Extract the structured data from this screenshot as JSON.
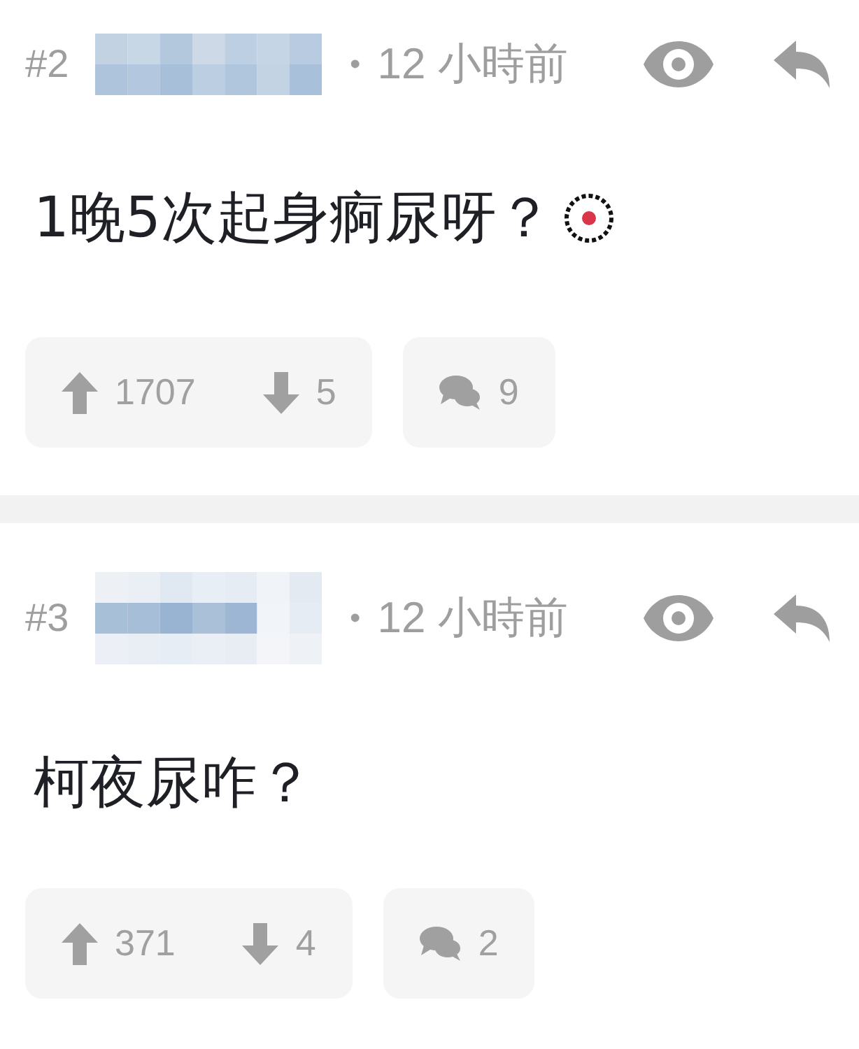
{
  "posts": [
    {
      "number": "#2",
      "separator": "•",
      "time": "12 小時前",
      "body": "1晚5次起身痾尿呀？",
      "emoji": true,
      "upvotes": "1707",
      "downvotes": "5",
      "replies": "9"
    },
    {
      "number": "#3",
      "separator": "•",
      "time": "12 小時前",
      "body": "柯夜尿咋？",
      "emoji": false,
      "upvotes": "371",
      "downvotes": "4",
      "replies": "2"
    }
  ]
}
